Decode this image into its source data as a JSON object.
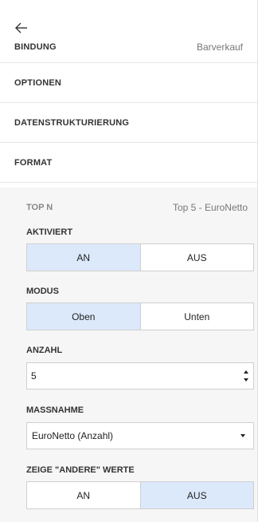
{
  "header": {
    "back_icon": "arrow-left-icon",
    "binding_label": "BINDUNG",
    "binding_value": "Barverkauf"
  },
  "sections": {
    "options": "OPTIONEN",
    "structuring": "DATENSTRUKTURIERUNG",
    "format": "FORMAT"
  },
  "topn": {
    "label": "TOP N",
    "value": "Top 5 - EuroNetto"
  },
  "enabled": {
    "label": "AKTIVIERT",
    "on": "AN",
    "off": "AUS",
    "selected": "AN"
  },
  "mode": {
    "label": "MODUS",
    "top": "Oben",
    "bottom": "Unten",
    "selected": "Oben"
  },
  "count": {
    "label": "ANZAHL",
    "value": "5"
  },
  "measure": {
    "label": "MASSNAHME",
    "value": "EuroNetto (Anzahl)"
  },
  "show_other": {
    "label": "ZEIGE \"ANDERE\" WERTE",
    "on": "AN",
    "off": "AUS",
    "selected": "AUS"
  },
  "colors": {
    "active_toggle": "#dce9fb",
    "sub_background": "#f6f6f6"
  }
}
